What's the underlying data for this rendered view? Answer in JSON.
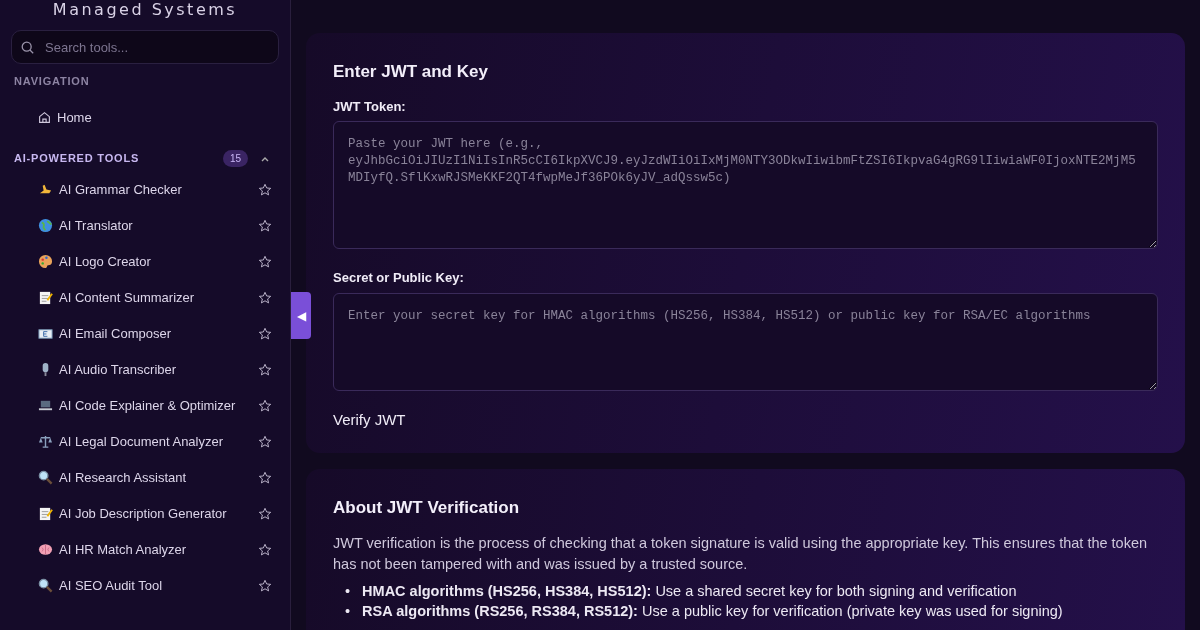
{
  "sidebar": {
    "brand": "Managed Systems",
    "search": {
      "placeholder": "Search tools..."
    },
    "nav_heading": "NAVIGATION",
    "nav_items": [
      {
        "label": "Home"
      }
    ],
    "section": {
      "title": "AI-POWERED TOOLS",
      "count": "15",
      "expanded": true,
      "items": [
        {
          "label": "AI Grammar Checker",
          "starred": false
        },
        {
          "label": "AI Translator",
          "starred": false
        },
        {
          "label": "AI Logo Creator",
          "starred": false
        },
        {
          "label": "AI Content Summarizer",
          "starred": false
        },
        {
          "label": "AI Email Composer",
          "starred": false
        },
        {
          "label": "AI Audio Transcriber",
          "starred": false
        },
        {
          "label": "AI Code Explainer & Optimizer",
          "starred": false
        },
        {
          "label": "AI Legal Document Analyzer",
          "starred": false
        },
        {
          "label": "AI Research Assistant",
          "starred": false
        },
        {
          "label": "AI Job Description Generator",
          "starred": false
        },
        {
          "label": "AI HR Match Analyzer",
          "starred": false
        },
        {
          "label": "AI SEO Audit Tool",
          "starred": false
        }
      ]
    },
    "collapsed": false,
    "toggle_glyph": "◀"
  },
  "form_card": {
    "title": "Enter JWT and Key",
    "jwt_label": "JWT Token:",
    "jwt_placeholder": "Paste your JWT here (e.g., eyJhbGciOiJIUzI1NiIsInR5cCI6IkpXVCJ9.eyJzdWIiOiIxMjM0NTY3ODkwIiwibmFtZSI6IkpvaG4gRG9lIiwiaWF0IjoxNTE2MjM5MDIyfQ.SflKxwRJSMeKKF2QT4fwpMeJf36POk6yJV_adQssw5c)",
    "key_label": "Secret or Public Key:",
    "key_placeholder": "Enter your secret key for HMAC algorithms (HS256, HS384, HS512) or public key for RSA/EC algorithms",
    "button": "Verify JWT"
  },
  "about_card": {
    "title": "About JWT Verification",
    "text": "JWT verification is the process of checking that a token signature is valid using the appropriate key. This ensures that the token has not been tampered with and was issued by a trusted source.",
    "bullets": [
      {
        "marker": "•",
        "text": "**HMAC algorithms (HS256, HS384, HS512):** Use a shared secret key for both signing and verification"
      },
      {
        "marker": "•",
        "text": "**RSA algorithms (RS256, RS384, RS512):** Use a public key for verification (private key was used for signing)"
      }
    ]
  }
}
